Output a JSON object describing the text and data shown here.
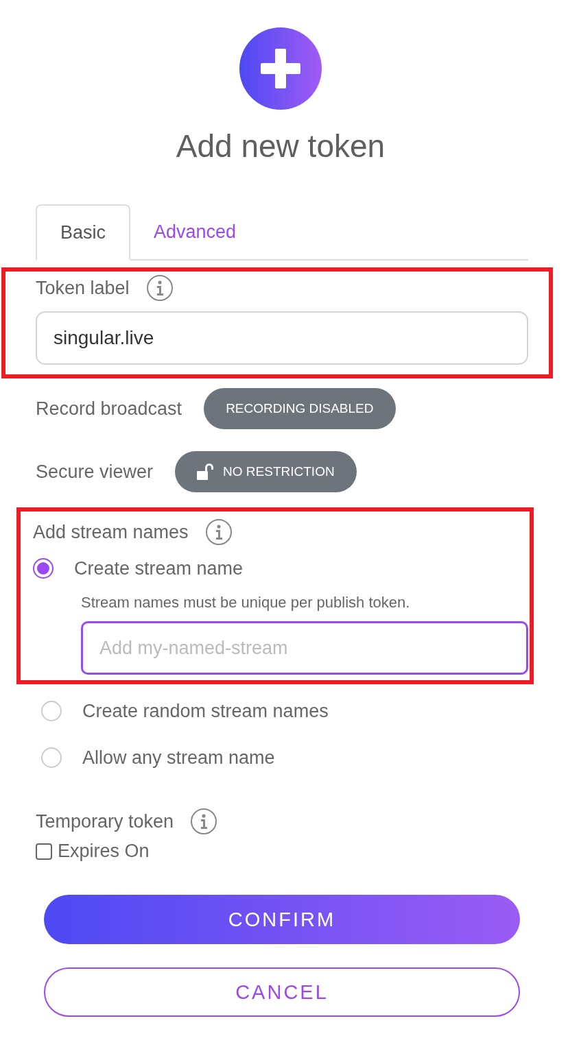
{
  "header": {
    "title": "Add new token"
  },
  "tabs": [
    {
      "label": "Basic",
      "selected": true
    },
    {
      "label": "Advanced",
      "selected": false
    }
  ],
  "token_label": {
    "label": "Token label",
    "value": "singular.live",
    "highlighted": true
  },
  "record_broadcast": {
    "label": "Record broadcast",
    "button": "RECORDING DISABLED"
  },
  "secure_viewer": {
    "label": "Secure viewer",
    "button": "NO RESTRICTION"
  },
  "stream_names": {
    "label": "Add stream names",
    "highlighted": true,
    "options": [
      {
        "label": "Create stream name",
        "selected": true,
        "hint": "Stream names must be unique per publish token.",
        "placeholder": "Add my-named-stream"
      },
      {
        "label": "Create random stream names",
        "selected": false
      },
      {
        "label": "Allow any stream name",
        "selected": false
      }
    ]
  },
  "temporary_token": {
    "label": "Temporary token",
    "expires": {
      "label": "Expires On",
      "checked": false
    }
  },
  "buttons": [
    {
      "label": "CONFIRM",
      "kind": "primary"
    },
    {
      "label": "CANCEL",
      "kind": "secondary"
    }
  ]
}
